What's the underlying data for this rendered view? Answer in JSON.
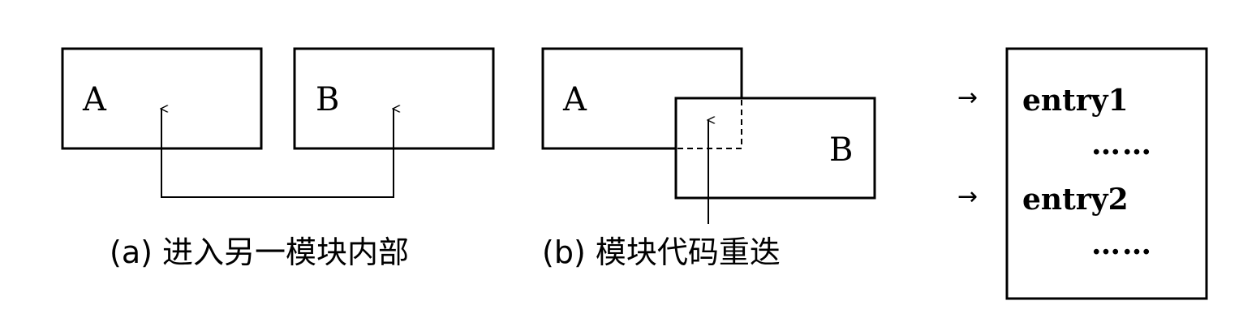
{
  "panel_a": {
    "box1_label": "A",
    "box2_label": "B",
    "caption": "(a)  进入另一模块内部"
  },
  "panel_b": {
    "box1_label": "A",
    "box2_label": "B",
    "caption": "(b)  模块代码重迭"
  },
  "panel_c": {
    "entry1": "entry1",
    "dots1": "……",
    "entry2": "entry2",
    "dots2": "……",
    "arrow_glyph": "→"
  }
}
